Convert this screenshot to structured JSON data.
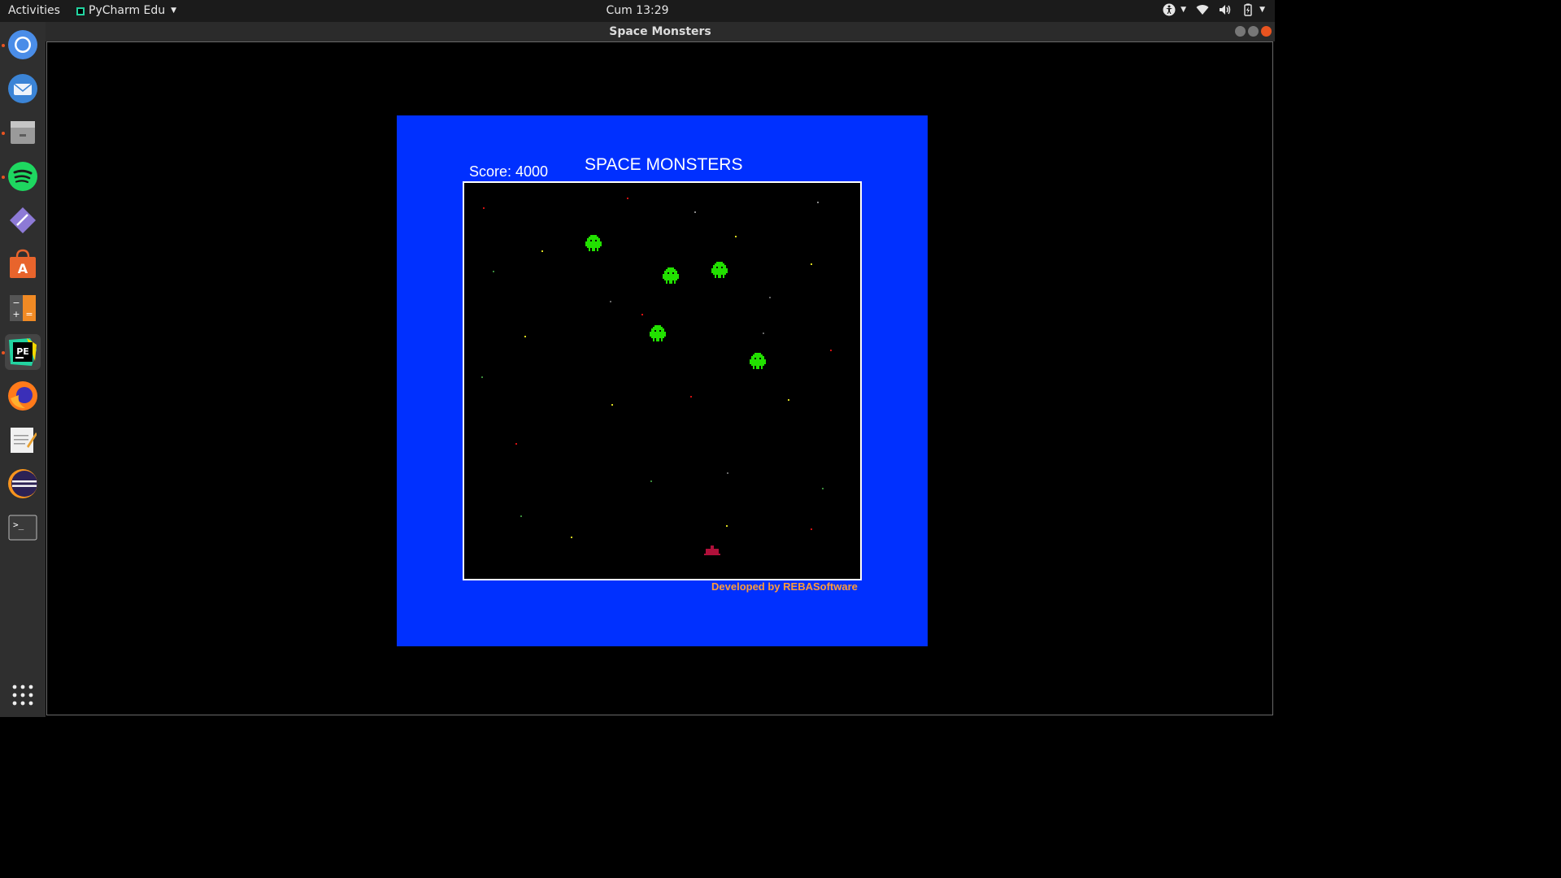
{
  "topbar": {
    "activities_label": "Activities",
    "app_name": "PyCharm Edu",
    "clock": "Cum 13:29"
  },
  "dock": {
    "items": [
      {
        "name": "chromium",
        "color": "#4a8de8"
      },
      {
        "name": "thunderbird",
        "color": "#3b84d6"
      },
      {
        "name": "files",
        "color": "#9a9a9a"
      },
      {
        "name": "spotify",
        "color": "#1ed760"
      },
      {
        "name": "editor",
        "color": "#8d7ad6"
      },
      {
        "name": "software-center",
        "color": "#e8642c"
      },
      {
        "name": "calculator",
        "color": "#f08a24"
      },
      {
        "name": "pycharm-edu",
        "color": "#22d3a0"
      },
      {
        "name": "firefox",
        "color": "#ff7a1a"
      },
      {
        "name": "text-editor",
        "color": "#f0f0f0"
      },
      {
        "name": "eclipse",
        "color": "#2c2255"
      },
      {
        "name": "terminal",
        "color": "#3a3a3a"
      }
    ]
  },
  "window": {
    "title": "Space Monsters"
  },
  "game": {
    "title": "SPACE MONSTERS",
    "score_label": "Score: 4000",
    "credit": "Developed by REBASoftware",
    "background_color": "#0030ff",
    "monster_color": "#22e000",
    "player_color": "#b0103a"
  }
}
